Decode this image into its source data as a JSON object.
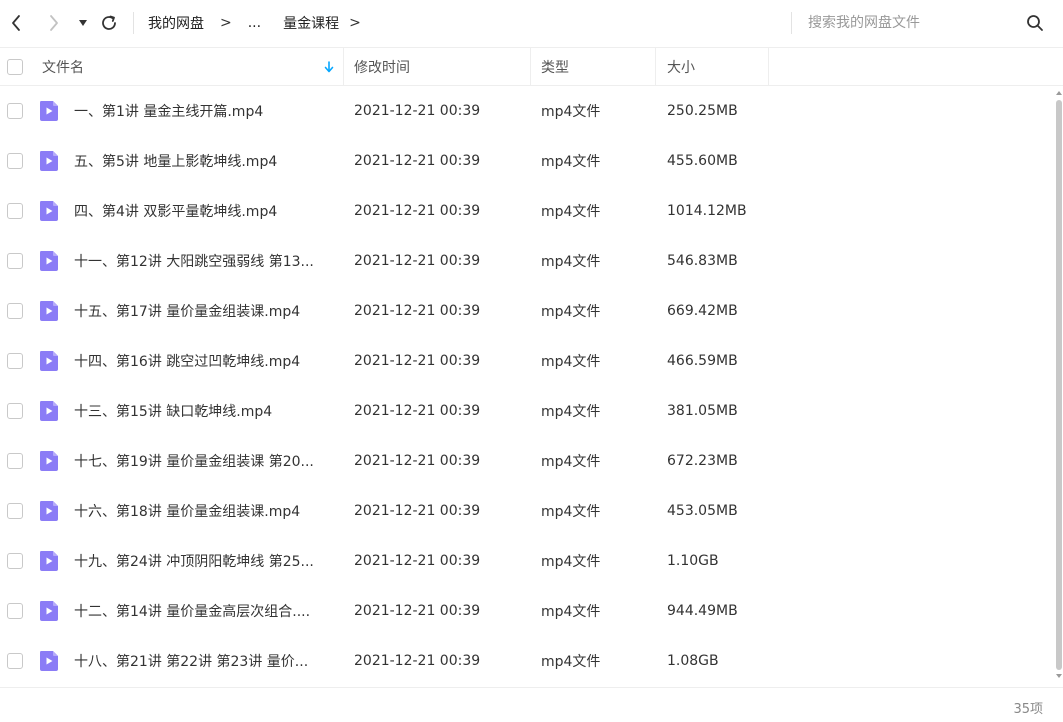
{
  "navbar": {
    "back_icon": "chevron-left-icon",
    "forward_icon": "chevron-right-icon",
    "history_icon": "caret-down-icon",
    "refresh_icon": "refresh-icon",
    "breadcrumb": {
      "root": "我的网盘",
      "sep1": ">",
      "ellipsis": "...",
      "current": "量金课程",
      "sep2": ">"
    },
    "search": {
      "placeholder": "搜索我的网盘文件",
      "value": "",
      "icon": "search-icon"
    }
  },
  "columns": {
    "name": "文件名",
    "modified": "修改时间",
    "type": "类型",
    "size": "大小",
    "sort_icon": "sort-arrow-down-icon"
  },
  "files": [
    {
      "name": "一、第1讲 量金主线开篇.mp4",
      "modified": "2021-12-21 00:39",
      "type": "mp4文件",
      "size": "250.25MB"
    },
    {
      "name": "五、第5讲 地量上影乾坤线.mp4",
      "modified": "2021-12-21 00:39",
      "type": "mp4文件",
      "size": "455.60MB"
    },
    {
      "name": "四、第4讲 双影平量乾坤线.mp4",
      "modified": "2021-12-21 00:39",
      "type": "mp4文件",
      "size": "1014.12MB"
    },
    {
      "name": "十一、第12讲 大阳跳空强弱线  第13...",
      "modified": "2021-12-21 00:39",
      "type": "mp4文件",
      "size": "546.83MB"
    },
    {
      "name": "十五、第17讲 量价量金组装课.mp4",
      "modified": "2021-12-21 00:39",
      "type": "mp4文件",
      "size": "669.42MB"
    },
    {
      "name": "十四、第16讲 跳空过凹乾坤线.mp4",
      "modified": "2021-12-21 00:39",
      "type": "mp4文件",
      "size": "466.59MB"
    },
    {
      "name": "十三、第15讲 缺口乾坤线.mp4",
      "modified": "2021-12-21 00:39",
      "type": "mp4文件",
      "size": "381.05MB"
    },
    {
      "name": "十七、第19讲 量价量金组装课  第20...",
      "modified": "2021-12-21 00:39",
      "type": "mp4文件",
      "size": "672.23MB"
    },
    {
      "name": "十六、第18讲 量价量金组装课.mp4",
      "modified": "2021-12-21 00:39",
      "type": "mp4文件",
      "size": "453.05MB"
    },
    {
      "name": "十九、第24讲 冲顶阴阳乾坤线  第25...",
      "modified": "2021-12-21 00:39",
      "type": "mp4文件",
      "size": "1.10GB"
    },
    {
      "name": "十二、第14讲 量价量金高层次组合....",
      "modified": "2021-12-21 00:39",
      "type": "mp4文件",
      "size": "944.49MB"
    },
    {
      "name": "十八、第21讲 第22讲 第23讲 量价...",
      "modified": "2021-12-21 00:39",
      "type": "mp4文件",
      "size": "1.08GB"
    }
  ],
  "file_icon": "video-file-icon",
  "file_icon_color": "#8b7cf6",
  "accent_color": "#06a7ff",
  "footer": {
    "count": "35项"
  }
}
